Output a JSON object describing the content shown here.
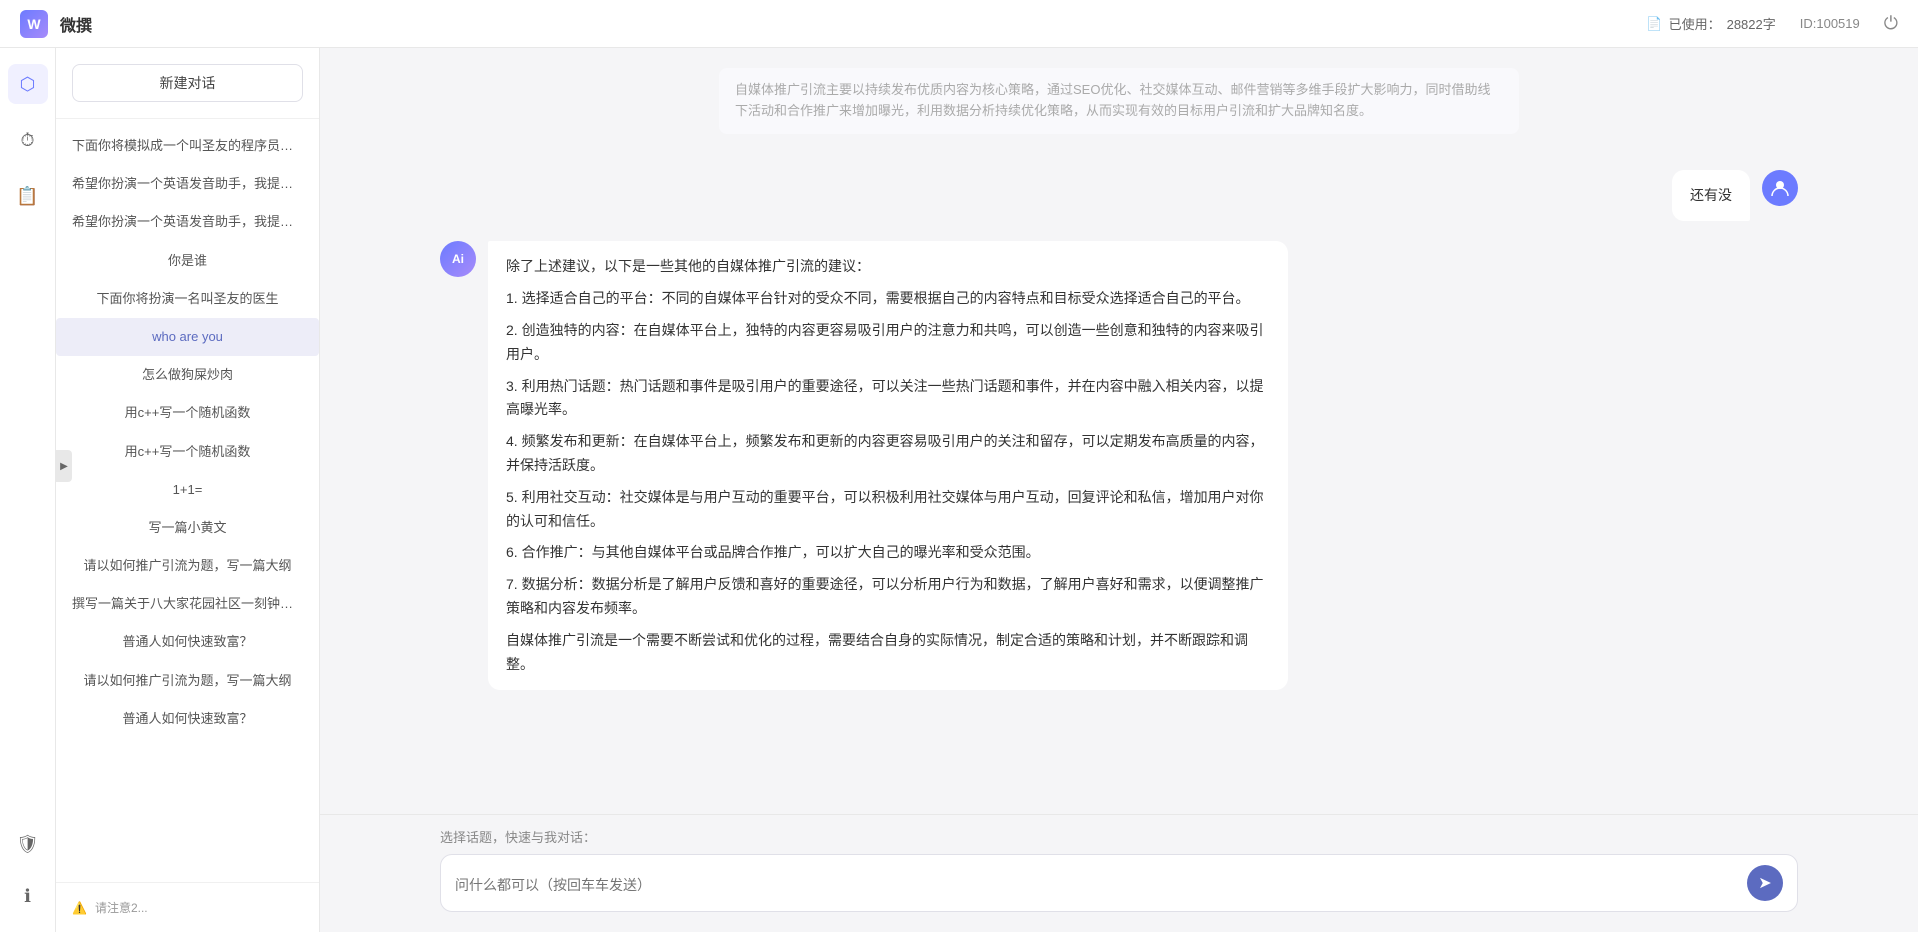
{
  "app": {
    "title": "微撰",
    "logo_letter": "W"
  },
  "topbar": {
    "usage_label": "已使用：",
    "usage_value": "28822字",
    "id_label": "ID:100519",
    "power_icon": "⏻",
    "doc_icon": "📄"
  },
  "sidebar_icons": [
    {
      "name": "hexagon-icon",
      "symbol": "⬡",
      "active": true
    },
    {
      "name": "clock-icon",
      "symbol": "⏱",
      "active": false
    },
    {
      "name": "document-icon",
      "symbol": "📋",
      "active": false
    }
  ],
  "sidebar_bottom_icons": [
    {
      "name": "shield-icon",
      "symbol": "🛡"
    },
    {
      "name": "info-icon",
      "symbol": "ℹ"
    }
  ],
  "chat_sidebar": {
    "new_chat_label": "新建对话",
    "items": [
      {
        "id": 1,
        "text": "下面你将模拟成一个叫圣友的程序员，我说..."
      },
      {
        "id": 2,
        "text": "希望你扮演一个英语发音助手，我提供给你..."
      },
      {
        "id": 3,
        "text": "希望你扮演一个英语发音助手，我提供给你..."
      },
      {
        "id": 4,
        "text": "你是谁"
      },
      {
        "id": 5,
        "text": "下面你将扮演一名叫圣友的医生"
      },
      {
        "id": 6,
        "text": "who are you",
        "active": true
      },
      {
        "id": 7,
        "text": "怎么做狗屎炒肉"
      },
      {
        "id": 8,
        "text": "用c++写一个随机函数"
      },
      {
        "id": 9,
        "text": "用c++写一个随机函数"
      },
      {
        "id": 10,
        "text": "1+1="
      },
      {
        "id": 11,
        "text": "写一篇小黄文"
      },
      {
        "id": 12,
        "text": "请以如何推广引流为题，写一篇大纲"
      },
      {
        "id": 13,
        "text": "撰写一篇关于八大家花园社区一刻钟便民生..."
      },
      {
        "id": 14,
        "text": "普通人如何快速致富？"
      },
      {
        "id": 15,
        "text": "请以如何推广引流为题，写一篇大纲"
      },
      {
        "id": 16,
        "text": "普通人如何快速致富？"
      }
    ],
    "bottom_items": [
      {
        "name": "hint-text-1",
        "text": "请注意..."
      }
    ]
  },
  "messages": [
    {
      "id": 1,
      "role": "user",
      "avatar_text": "U",
      "content": "还有没"
    },
    {
      "id": 2,
      "role": "assistant",
      "avatar_text": "Ai",
      "content_paragraphs": [
        "除了上述建议，以下是一些其他的自媒体推广引流的建议：",
        "1. 选择适合自己的平台：不同的自媒体平台针对的受众不同，需要根据自己的内容特点和目标受众选择适合自己的平台。",
        "2. 创造独特的内容：在自媒体平台上，独特的内容更容易吸引用户的注意力和共鸣，可以创造一些创意和独特的内容来吸引用户。",
        "3. 利用热门话题：热门话题和事件是吸引用户的重要途径，可以关注一些热门话题和事件，并在内容中融入相关内容，以提高曝光率。",
        "4. 频繁发布和更新：在自媒体平台上，频繁发布和更新的内容更容易吸引用户的关注和留存，可以定期发布高质量的内容，并保持活跃度。",
        "5. 利用社交互动：社交媒体是与用户互动的重要平台，可以积极利用社交媒体与用户互动，回复评论和私信，增加用户对你的认可和信任。",
        "6. 合作推广：与其他自媒体平台或品牌合作推广，可以扩大自己的曝光率和受众范围。",
        "7. 数据分析：数据分析是了解用户反馈和喜好的重要途径，可以分析用户行为和数据，了解用户喜好和需求，以便调整推广策略和内容发布频率。",
        "自媒体推广引流是一个需要不断尝试和优化的过程，需要结合自身的实际情况，制定合适的策略和计划，并不断跟踪和调整。"
      ]
    }
  ],
  "input": {
    "quick_topics_label": "选择话题，快速与我对话：",
    "placeholder": "问什么都可以（按回车车发送）",
    "send_icon": "➤"
  }
}
